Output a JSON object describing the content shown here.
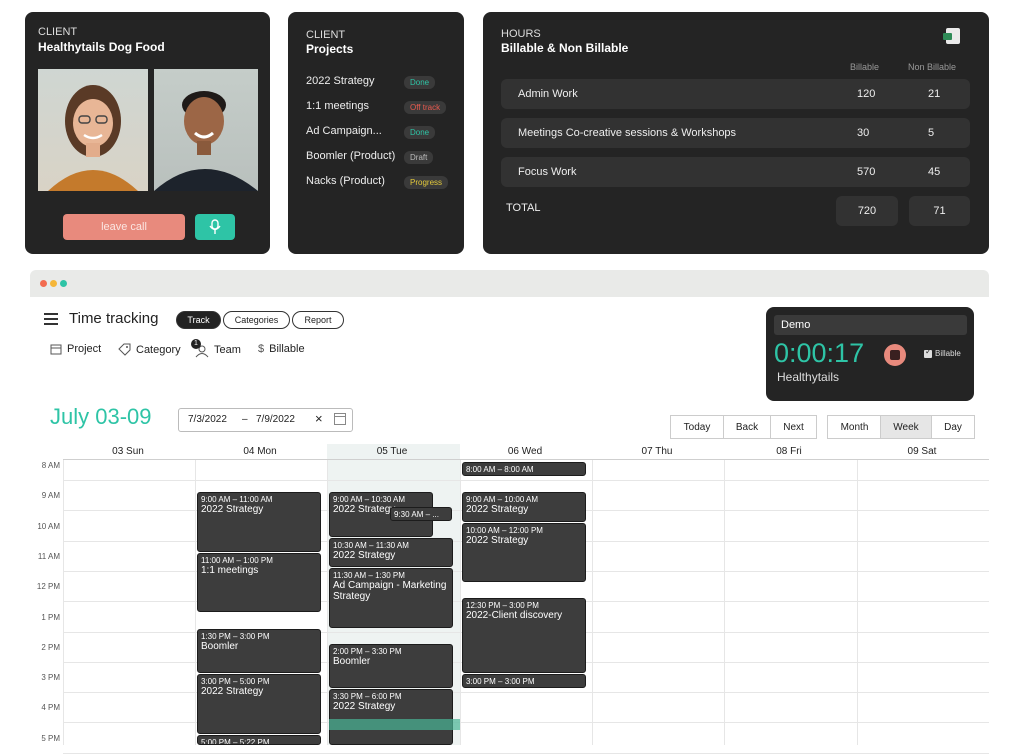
{
  "client_card": {
    "label": "CLIENT",
    "name": "Healthytails Dog Food",
    "leave_label": "leave call"
  },
  "projects_card": {
    "label": "CLIENT",
    "title": "Projects",
    "items": [
      {
        "name": "2022 Strategy",
        "status": "Done",
        "color": "#2ec4a6"
      },
      {
        "name": "1:1 meetings",
        "status": "Off track",
        "color": "#e85a4f"
      },
      {
        "name": "Ad Campaign...",
        "status": "Done",
        "color": "#2ec4a6"
      },
      {
        "name": "Boomler (Product)",
        "status": "Draft",
        "color": "#bbbbbb"
      },
      {
        "name": "Nacks (Product)",
        "status": "Progress",
        "color": "#e3c93b"
      }
    ]
  },
  "hours_card": {
    "label": "HOURS",
    "title": "Billable & Non Billable",
    "col_billable": "Billable",
    "col_non_billable": "Non Billable",
    "rows": [
      {
        "name": "Admin Work",
        "billable": "120",
        "non_billable": "21"
      },
      {
        "name": "Meetings Co-creative sessions & Workshops",
        "billable": "30",
        "non_billable": "5"
      },
      {
        "name": "Focus Work",
        "billable": "570",
        "non_billable": "45"
      }
    ],
    "total_label": "TOTAL",
    "total_billable": "720",
    "total_non_billable": "71"
  },
  "tracker": {
    "title": "Time tracking",
    "tabs": [
      "Track",
      "Categories",
      "Report"
    ],
    "filters": {
      "project": "Project",
      "category": "Category",
      "team": "Team",
      "team_count": "1",
      "billable": "Billable"
    },
    "timer": {
      "task": "Demo",
      "time": "0:00:17",
      "client": "Healthytails",
      "billable_label": "Billable"
    }
  },
  "calendar": {
    "range_title": "July 03-09",
    "date_from": "7/3/2022",
    "date_sep": "–",
    "date_to": "7/9/2022",
    "nav": {
      "today": "Today",
      "back": "Back",
      "next": "Next"
    },
    "views": {
      "month": "Month",
      "week": "Week",
      "day": "Day"
    },
    "days": [
      "03 Sun",
      "04 Mon",
      "05 Tue",
      "06 Wed",
      "07 Thu",
      "08 Fri",
      "09 Sat"
    ],
    "hours": [
      "8 AM",
      "9 AM",
      "10 AM",
      "11 AM",
      "12 PM",
      "1 PM",
      "2 PM",
      "3 PM",
      "4 PM",
      "5 PM"
    ],
    "events": [
      {
        "day": 1,
        "start": 9.0,
        "end": 11.0,
        "time": "9:00 AM – 11:00 AM",
        "title": "2022 Strategy"
      },
      {
        "day": 1,
        "start": 11.0,
        "end": 13.0,
        "time": "11:00 AM – 1:00 PM",
        "title": "1:1 meetings"
      },
      {
        "day": 1,
        "start": 13.5,
        "end": 15.0,
        "time": "1:30 PM – 3:00 PM",
        "title": "Boomler"
      },
      {
        "day": 1,
        "start": 15.0,
        "end": 17.0,
        "time": "3:00 PM – 5:00 PM",
        "title": "2022 Strategy"
      },
      {
        "day": 1,
        "start": 17.0,
        "end": 17.37,
        "time": "5:00 PM – 5:22 PM",
        "title": ""
      },
      {
        "day": 2,
        "start": 9.0,
        "end": 10.5,
        "time": "9:00 AM – 10:30 AM",
        "title": "2022 Strategy",
        "narrow": true
      },
      {
        "day": 2,
        "start": 9.5,
        "end": 10.0,
        "time": "9:30 AM – ...",
        "title": "",
        "overlap": true
      },
      {
        "day": 2,
        "start": 10.5,
        "end": 11.5,
        "time": "10:30 AM – 11:30 AM",
        "title": "2022 Strategy"
      },
      {
        "day": 2,
        "start": 11.5,
        "end": 13.5,
        "time": "11:30 AM – 1:30 PM",
        "title": "Ad Campaign - Marketing Strategy"
      },
      {
        "day": 2,
        "start": 14.0,
        "end": 15.5,
        "time": "2:00 PM – 3:30 PM",
        "title": "Boomler"
      },
      {
        "day": 2,
        "start": 15.5,
        "end": 18.0,
        "time": "3:30 PM – 6:00 PM",
        "title": "2022 Strategy"
      },
      {
        "day": 3,
        "start": 8.0,
        "end": 8.5,
        "time": "8:00 AM – 8:00 AM",
        "title": ""
      },
      {
        "day": 3,
        "start": 9.0,
        "end": 10.0,
        "time": "9:00 AM – 10:00 AM",
        "title": "2022 Strategy"
      },
      {
        "day": 3,
        "start": 10.0,
        "end": 12.0,
        "time": "10:00 AM – 12:00 PM",
        "title": "2022 Strategy"
      },
      {
        "day": 3,
        "start": 12.5,
        "end": 15.0,
        "time": "12:30 PM – 3:00 PM",
        "title": "2022-Client discovery"
      },
      {
        "day": 3,
        "start": 15.0,
        "end": 15.5,
        "time": "3:00 PM – 3:00 PM",
        "title": ""
      }
    ]
  },
  "colors": {
    "accent": "#2ec4a6",
    "card": "#242424",
    "stop": "#e88a7d"
  }
}
